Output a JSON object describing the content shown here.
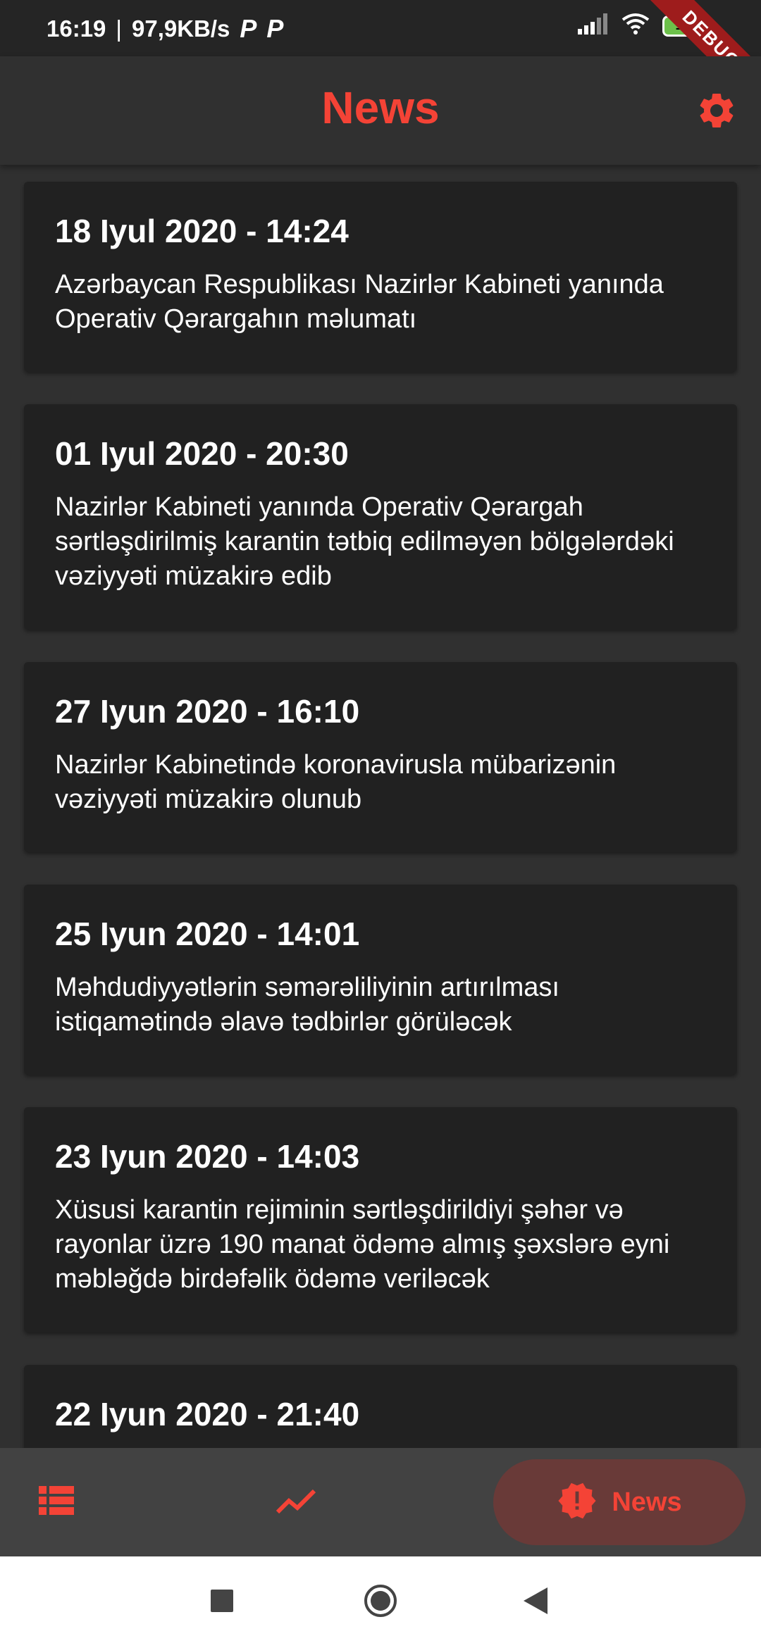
{
  "status_bar": {
    "time": "16:19",
    "network_speed": "97,9KB/s",
    "notification_icons": [
      "P",
      "P"
    ],
    "battery_level": "100",
    "debug_label": "DEBUG"
  },
  "app_bar": {
    "title": "News",
    "settings_icon": "gear-icon",
    "accent_color": "#f44336"
  },
  "news": [
    {
      "date": "18 Iyul 2020 - 14:24",
      "text": "Azərbaycan Respublikası Nazirlər Kabineti yanında Operativ Qərargahın məlumatı"
    },
    {
      "date": "01 Iyul 2020 - 20:30",
      "text": "Nazirlər Kabineti yanında Operativ Qərargah sərtləşdirilmiş karantin tətbiq edilməyən bölgələrdəki vəziyyəti müzakirə edib"
    },
    {
      "date": "27 Iyun 2020 - 16:10",
      "text": "Nazirlər Kabinetində koronavirusla mübarizənin vəziyyəti müzakirə olunub"
    },
    {
      "date": "25 Iyun 2020 - 14:01",
      "text": "Məhdudiyyətlərin səmərəliliyinin artırılması istiqamətində əlavə tədbirlər görüləcək"
    },
    {
      "date": "23 Iyun 2020 - 14:03",
      "text": "Xüsusi karantin rejiminin sərtləşdirildiyi şəhər və rayonlar üzrə 190 manat ödəmə almış şəxslərə eyni məbləğdə birdəfəlik ödəmə veriləcək"
    },
    {
      "date": "22 Iyun 2020 - 21:40",
      "text": ""
    }
  ],
  "bottom_nav": {
    "items": [
      {
        "icon": "list-icon",
        "label": ""
      },
      {
        "icon": "trending-up-icon",
        "label": ""
      },
      {
        "icon": "news-alert-icon",
        "label": "News",
        "active": true
      }
    ]
  },
  "system_nav": {
    "icons": [
      "recents-square-icon",
      "home-circle-icon",
      "back-triangle-icon"
    ]
  }
}
